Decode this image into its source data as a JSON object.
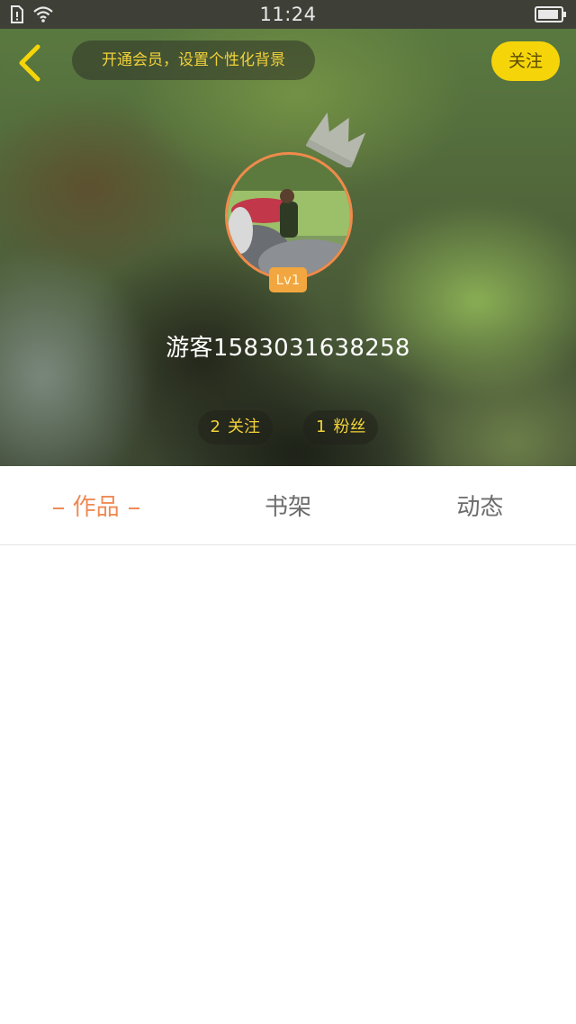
{
  "status_bar": {
    "time": "11:24"
  },
  "header": {
    "vip_banner": "开通会员，设置个性化背景",
    "follow_label": "关注",
    "level_badge": "Lv1",
    "username": "游客1583031638258",
    "stats": [
      {
        "count": "2",
        "label": "关注"
      },
      {
        "count": "1",
        "label": "粉丝"
      }
    ]
  },
  "tabs": [
    {
      "label": "作品",
      "active": true
    },
    {
      "label": "书架",
      "active": false
    },
    {
      "label": "动态",
      "active": false
    }
  ],
  "colors": {
    "accent_yellow": "#f5d50a",
    "accent_orange": "#ef8a55",
    "avatar_border": "#f08a4b",
    "level_badge_bg": "#f2a640"
  },
  "icons": {
    "back": "chevron-left-icon",
    "crown": "crown-icon",
    "wifi": "wifi-icon",
    "sim": "sim-icon",
    "battery": "battery-icon"
  }
}
